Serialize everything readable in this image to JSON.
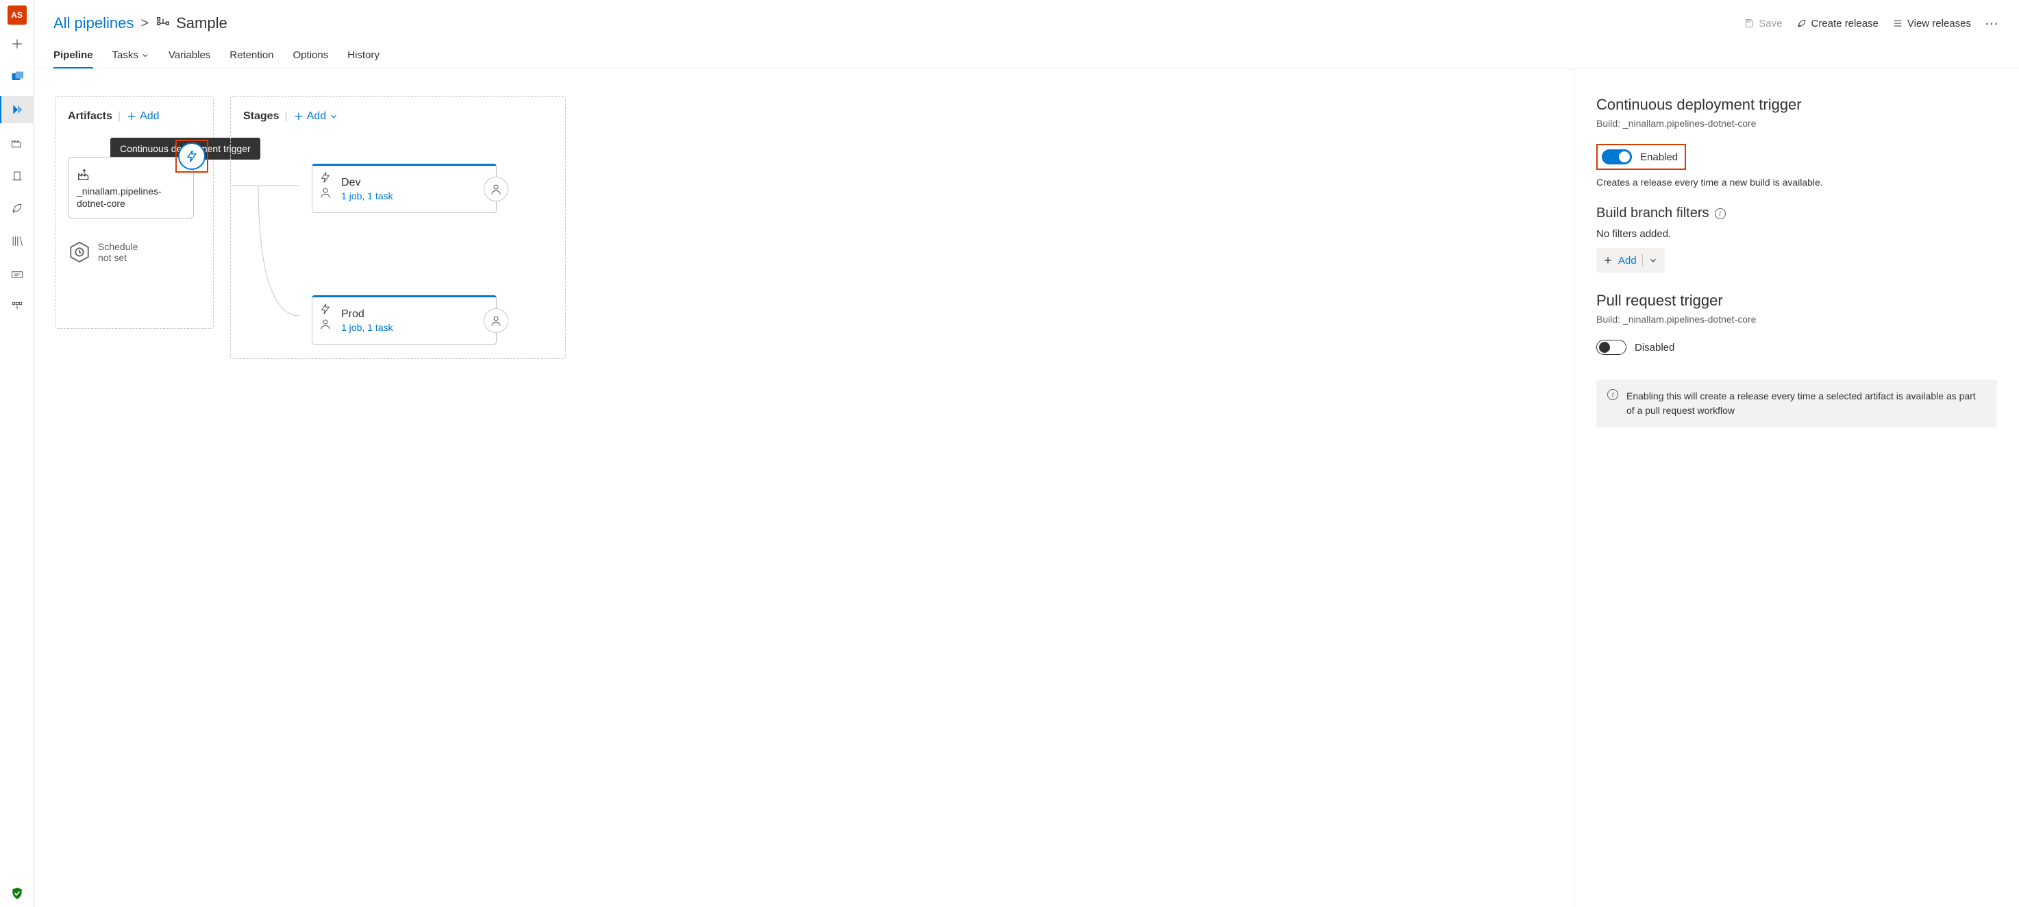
{
  "rail": {
    "avatar_initials": "AS"
  },
  "breadcrumb": {
    "root": "All pipelines",
    "separator": ">",
    "title": "Sample"
  },
  "header_actions": {
    "save": "Save",
    "create_release": "Create release",
    "view_releases": "View releases"
  },
  "tabs": {
    "pipeline": "Pipeline",
    "tasks": "Tasks",
    "variables": "Variables",
    "retention": "Retention",
    "options": "Options",
    "history": "History"
  },
  "canvas": {
    "artifacts_header": "Artifacts",
    "stages_header": "Stages",
    "add_label": "Add",
    "tooltip": "Continuous deployment trigger",
    "artifact": {
      "name": "_ninallam.pipelines-dotnet-core"
    },
    "schedule": {
      "line1": "Schedule",
      "line2": "not set"
    },
    "stages": [
      {
        "name": "Dev",
        "sub": "1 job, 1 task"
      },
      {
        "name": "Prod",
        "sub": "1 job, 1 task"
      }
    ]
  },
  "panel": {
    "cd_title": "Continuous deployment trigger",
    "cd_build_label": "Build: _ninallam.pipelines-dotnet-core",
    "cd_enabled_label": "Enabled",
    "cd_hint": "Creates a release every time a new build is available.",
    "branch_filters_title": "Build branch filters",
    "no_filters": "No filters added.",
    "add_label": "Add",
    "pr_title": "Pull request trigger",
    "pr_build_label": "Build: _ninallam.pipelines-dotnet-core",
    "pr_disabled_label": "Disabled",
    "pr_banner": "Enabling this will create a release every time a selected artifact is available as part of a pull request workflow"
  }
}
